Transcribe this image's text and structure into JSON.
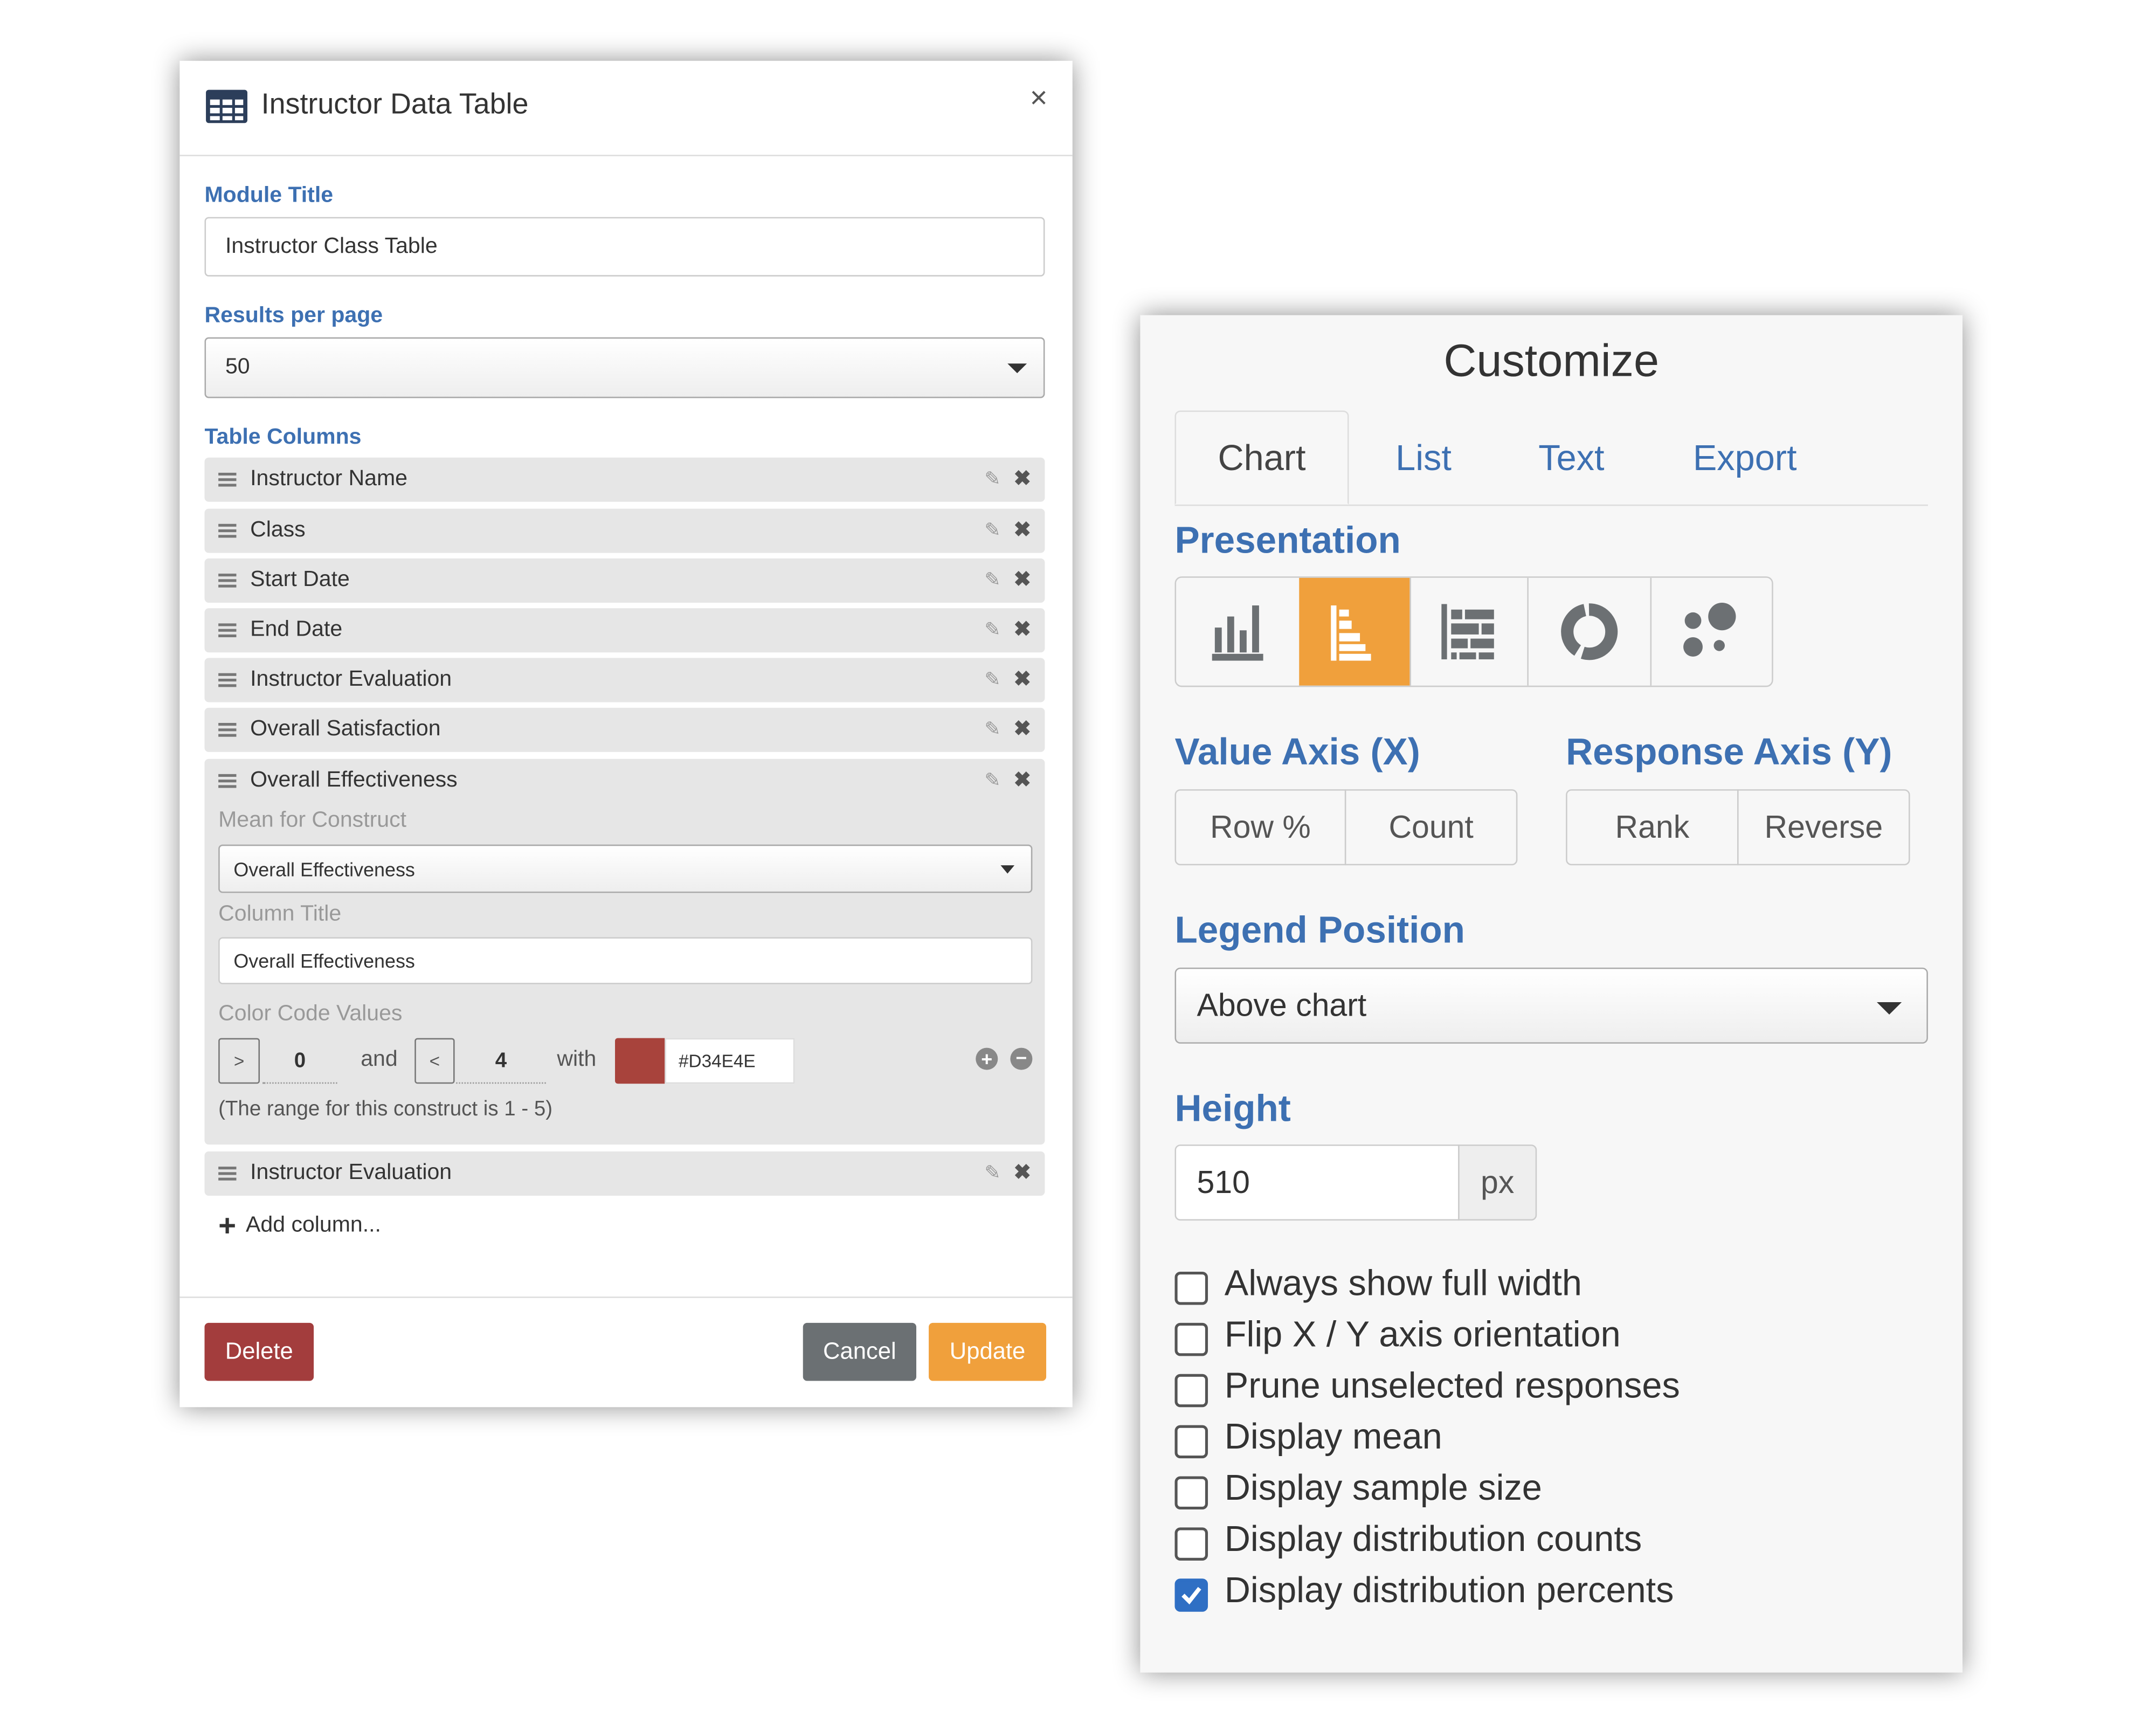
{
  "left_panel": {
    "title": "Instructor Data Table",
    "close": "×",
    "module_title_label": "Module Title",
    "module_title_value": "Instructor Class Table",
    "results_label": "Results per page",
    "results_value": "50",
    "columns_label": "Table Columns",
    "columns": [
      {
        "label": "Instructor Name"
      },
      {
        "label": "Class"
      },
      {
        "label": "Start Date"
      },
      {
        "label": "End Date"
      },
      {
        "label": "Instructor Evaluation"
      },
      {
        "label": "Overall Satisfaction"
      },
      {
        "label": "Overall Effectiveness"
      },
      {
        "label": "Instructor Evaluation"
      }
    ],
    "expanded": {
      "mean_label": "Mean for Construct",
      "mean_value": "Overall Effectiveness",
      "column_title_label": "Column Title",
      "column_title_value": "Overall Effectiveness",
      "color_code_label": "Color Code Values",
      "op1": ">",
      "val1": "0",
      "and": "and",
      "op2": "<",
      "val2": "4",
      "with": "with",
      "color_hex": "#D34E4E",
      "swatch_color": "#a8433c",
      "range_note": "(The range for this construct is 1 - 5)"
    },
    "add_column": "Add column...",
    "delete": "Delete",
    "cancel": "Cancel",
    "update": "Update",
    "colors": {
      "delete": "#a33d3d",
      "cancel": "#6b7073",
      "update": "#f0a03c",
      "label": "#3d70b2"
    }
  },
  "right_panel": {
    "title": "Customize",
    "tabs": [
      {
        "label": "Chart",
        "active": true
      },
      {
        "label": "List"
      },
      {
        "label": "Text"
      },
      {
        "label": "Export"
      }
    ],
    "presentation_label": "Presentation",
    "presentation_options": [
      {
        "icon": "vertical-bar-chart-icon"
      },
      {
        "icon": "horizontal-bar-chart-icon",
        "active": true
      },
      {
        "icon": "stacked-bar-chart-icon"
      },
      {
        "icon": "donut-chart-icon"
      },
      {
        "icon": "bubble-chart-icon"
      }
    ],
    "value_axis_label": "Value Axis (X)",
    "value_axis_options": [
      "Row %",
      "Count"
    ],
    "response_axis_label": "Response Axis (Y)",
    "response_axis_options": [
      "Rank",
      "Reverse"
    ],
    "legend_label": "Legend Position",
    "legend_value": "Above chart",
    "height_label": "Height",
    "height_value": "510",
    "height_unit": "px",
    "options": [
      {
        "label": "Always show full width",
        "checked": false
      },
      {
        "label": "Flip X / Y axis orientation",
        "checked": false
      },
      {
        "label": "Prune unselected responses",
        "checked": false
      },
      {
        "label": "Display mean",
        "checked": false
      },
      {
        "label": "Display sample size",
        "checked": false
      },
      {
        "label": "Display distribution counts",
        "checked": false
      },
      {
        "label": "Display distribution percents",
        "checked": true
      }
    ],
    "accent": "#f0a03c",
    "check_color": "#2f6fc4"
  }
}
